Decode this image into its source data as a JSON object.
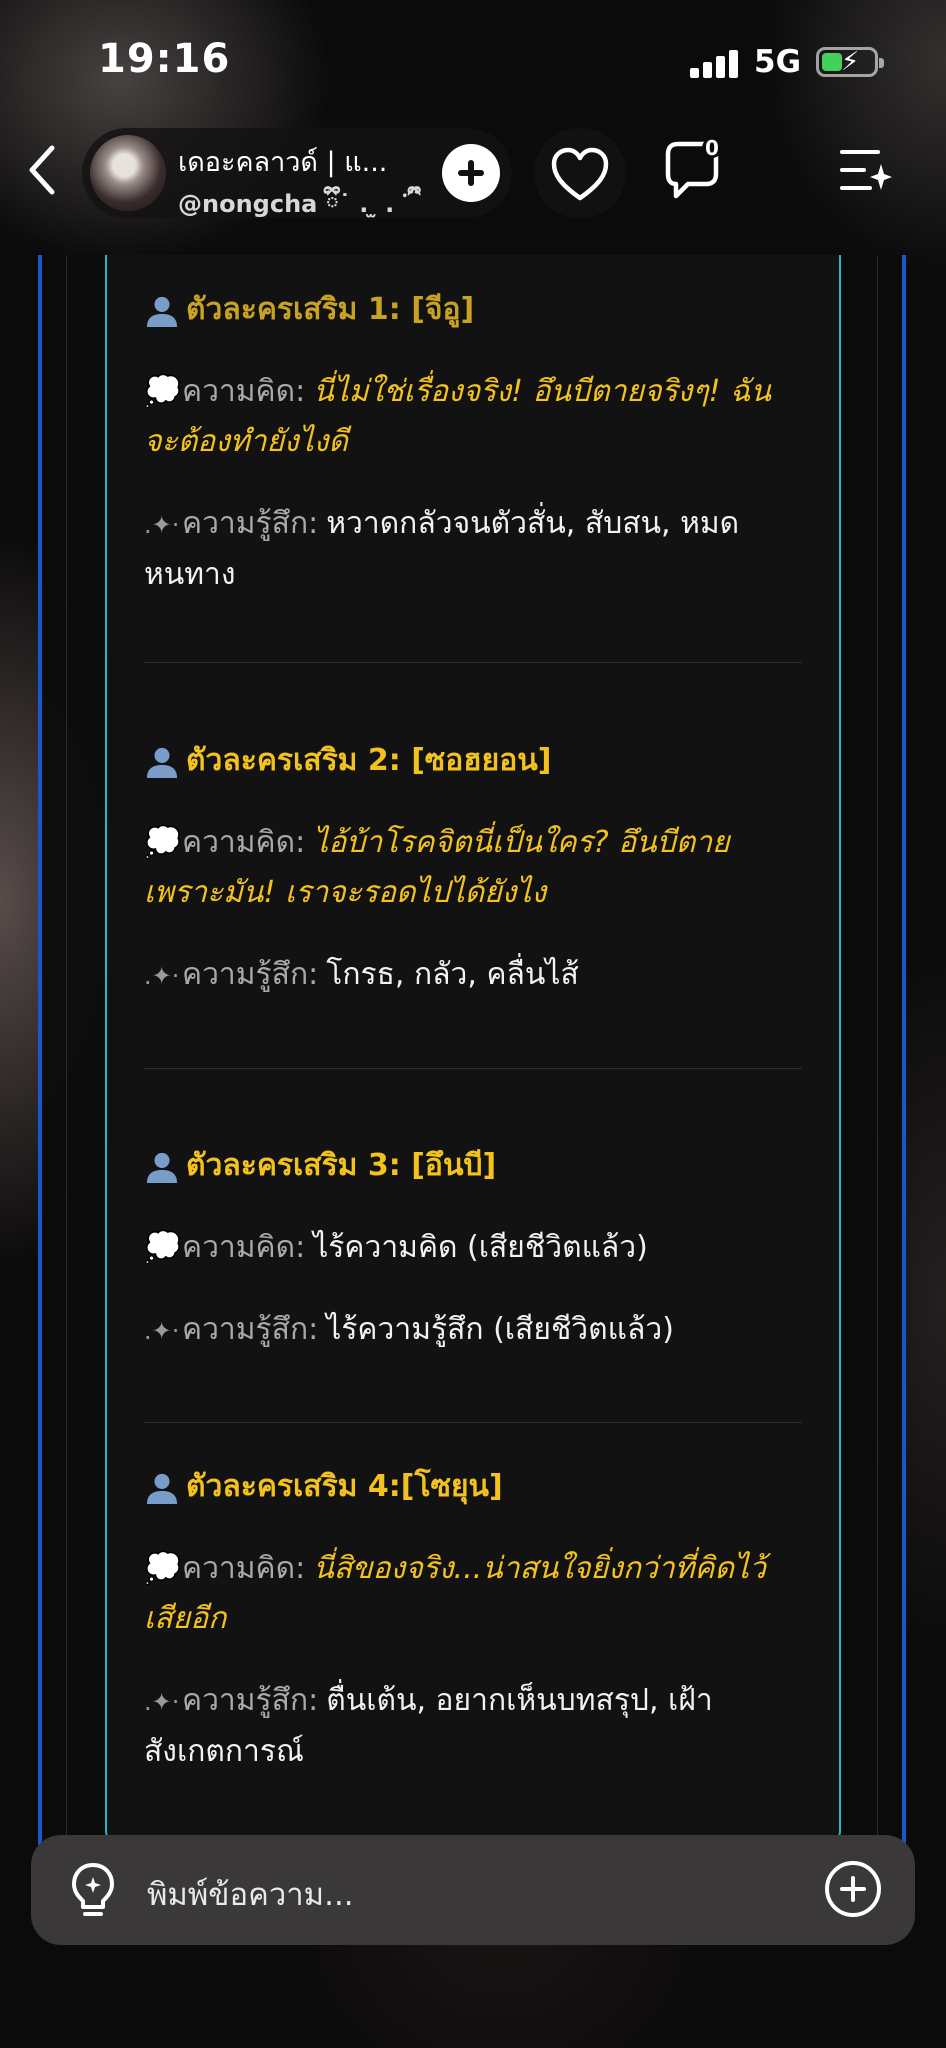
{
  "status_bar": {
    "time": "19:16",
    "network": "5G"
  },
  "header": {
    "bot_name": "เดอะคลาวด์ | แ...",
    "bot_handle": "@nongcha ྀི˙ . ̫ . ˙ྀི"
  },
  "characters": [
    {
      "title": "ตัวละครเสริม 1: [จีอู]",
      "thought_label": "ความคิด:",
      "thought": "นี่ไม่ใช่เรื่องจริง! อึนบีตายจริงๆ! ฉันจะต้องทำยังไงดี",
      "feeling_label": "ความรู้สึก:",
      "feeling": "หวาดกลัวจนตัวสั่น, สับสน, หมดหนทาง"
    },
    {
      "title": "ตัวละครเสริม 2: [ซอฮยอน]",
      "thought_label": "ความคิด:",
      "thought": "ไอ้บ้าโรคจิตนี่เป็นใคร? อึนบีตายเพราะมัน! เราจะรอดไปได้ยังไง",
      "feeling_label": "ความรู้สึก:",
      "feeling": "โกรธ, กลัว, คลื่นไส้"
    },
    {
      "title": "ตัวละครเสริม 3: [อึนบี]",
      "thought_label": "ความคิด:",
      "thought": "ไร้ความคิด (เสียชีวิตแล้ว)",
      "feeling_label": "ความรู้สึก:",
      "feeling": "ไร้ความรู้สึก (เสียชีวิตแล้ว)"
    },
    {
      "title": "ตัวละครเสริม 4:[โซยุน]",
      "thought_label": "ความคิด:",
      "thought": "นี่สิของจริง...น่าสนใจยิ่งกว่าที่คิดไว้เสียอีก",
      "feeling_label": "ความรู้สึก:",
      "feeling": "ตื่นเต้น, อยากเห็นบทสรุป, เฝ้าสังเกตการณ์"
    }
  ],
  "input": {
    "placeholder": "พิมพ์ข้อความ..."
  },
  "icons": {
    "person": "person-icon",
    "thought": "thought-bubble-icon",
    "feeling": "sparkle-icon"
  },
  "colors": {
    "accent_yellow": "#f3c21c",
    "card_border": "#29b6c8",
    "outer_border": "#1a57c8",
    "battery": "#43d15a"
  }
}
